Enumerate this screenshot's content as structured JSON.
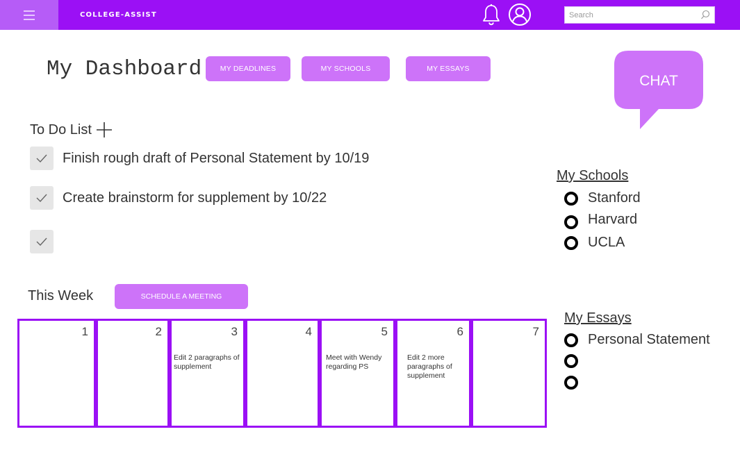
{
  "app": {
    "brand": "COLLEGE-ASSIST"
  },
  "search": {
    "placeholder": "Search"
  },
  "header": {
    "title": "My Dashboard",
    "nav": [
      "MY DEADLINES",
      "MY SCHOOLS",
      "MY ESSAYS"
    ],
    "chat_label": "CHAT"
  },
  "todo": {
    "title": "To Do List",
    "items": [
      {
        "text": "Finish rough draft of Personal Statement by 10/19"
      },
      {
        "text": "Create brainstorm for supplement by 10/22"
      },
      {
        "text": ""
      }
    ]
  },
  "schools": {
    "title": "My Schools",
    "items": [
      "Stanford",
      "Harvard",
      "UCLA"
    ]
  },
  "essays": {
    "title": "My Essays",
    "items": [
      "Personal Statement",
      "",
      ""
    ]
  },
  "week": {
    "title": "This Week",
    "meeting_button": "SCHEDULE A MEETING",
    "days": [
      {
        "num": "1",
        "note": ""
      },
      {
        "num": "2",
        "note": ""
      },
      {
        "num": "3",
        "note": "Edit 2 paragraphs of supplement"
      },
      {
        "num": "4",
        "note": ""
      },
      {
        "num": "5",
        "note": "Meet with Wendy regarding PS"
      },
      {
        "num": "6",
        "note": "Edit 2 more paragraphs of supplement"
      },
      {
        "num": "7",
        "note": ""
      }
    ]
  },
  "colors": {
    "accent": "#9b10f5",
    "button": "#cd73f9",
    "hamburger_bg": "#b65cf7"
  },
  "icons": [
    "menu-icon",
    "bell-icon",
    "profile-icon",
    "search-icon",
    "plus-icon",
    "check-icon",
    "chat-bubble-icon",
    "circle-bullet-icon"
  ]
}
